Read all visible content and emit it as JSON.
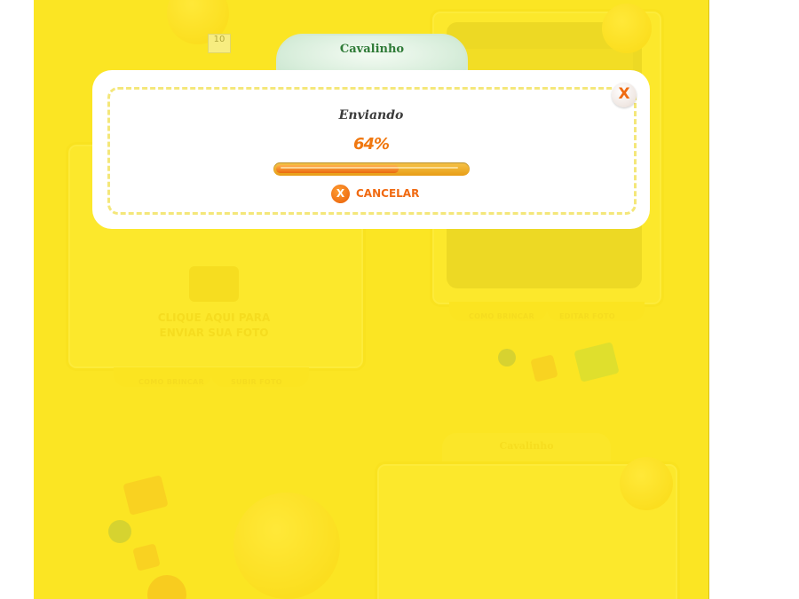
{
  "background": {
    "photo_card": {
      "hint_line1": "CLIQUE AQUI PARA",
      "hint_line2": "ENVIAR SUA FOTO",
      "tabs": [
        "COMO BRINCAR",
        "SUBIR FOTO"
      ]
    },
    "puzzle_card": {
      "tabs": [
        "COMO BRINCAR",
        "EDITAR FOTO"
      ]
    },
    "bottom_card": {
      "title": "Cavalinho"
    },
    "calendar_badge": "10"
  },
  "dialog": {
    "header_title": "Cavalinho",
    "close_glyph": "X",
    "status": "Enviando",
    "progress_label": "64%",
    "progress_value": 64,
    "cancel_icon": "X",
    "cancel_label": "CANCELAR"
  },
  "colors": {
    "accent": "#f07810",
    "header_text": "#2f7b37",
    "background_yellow": "#f6dc1e",
    "dialog_dash": "#f4e77a"
  }
}
